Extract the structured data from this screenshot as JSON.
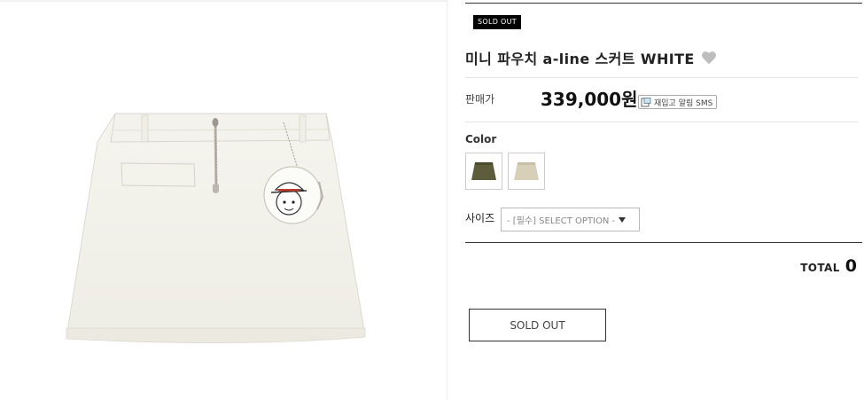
{
  "product": {
    "sold_out_badge": "SOLD OUT",
    "title": "미니 파우치 a-line 스커트 WHITE",
    "price_label": "판매가",
    "price": "339,000원",
    "restock_label": "재입고 알림 SMS",
    "color_label": "Color",
    "color_options": [
      {
        "name": "khaki",
        "color": "#5e5d3b"
      },
      {
        "name": "beige",
        "color": "#d8cfb8"
      }
    ],
    "size_label": "사이즈",
    "size_select_value": "- [필수] SELECT OPTION -",
    "total_label": "TOTAL",
    "total_value": "0",
    "sold_out_button": "SOLD OUT"
  },
  "icons": {
    "wishlist": "heart-icon",
    "restock": "sms-icon",
    "dropdown": "caret-down-icon"
  },
  "colors": {
    "badge_bg": "#000000",
    "heart": "#bdbdbd",
    "skirt": "#f2f1ea"
  }
}
